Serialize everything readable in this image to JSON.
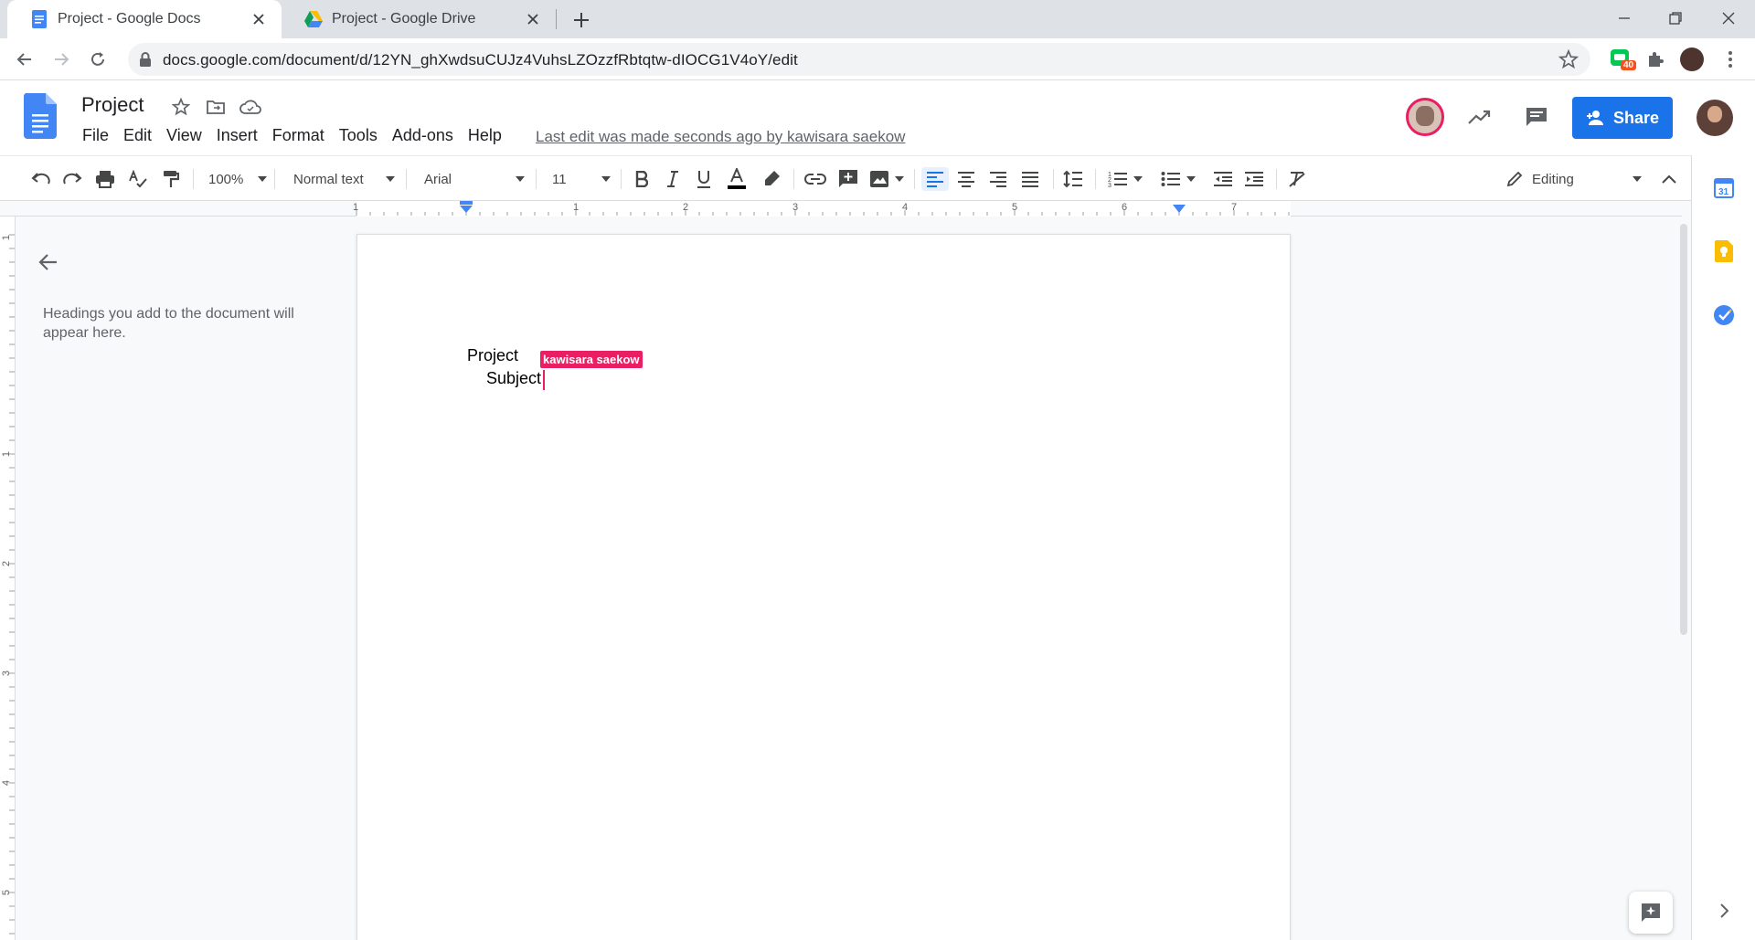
{
  "browser": {
    "tabs": [
      {
        "title": "Project - Google Docs",
        "active": true
      },
      {
        "title": "Project - Google Drive",
        "active": false
      }
    ],
    "url": "docs.google.com/document/d/12YN_ghXwdsuCUJz4VuhsLZOzzfRbtqtw-dIOCG1V4oY/edit",
    "extension_badge": "40"
  },
  "docs": {
    "title": "Project",
    "menu": [
      "File",
      "Edit",
      "View",
      "Insert",
      "Format",
      "Tools",
      "Add-ons",
      "Help"
    ],
    "last_edit": "Last edit was made seconds ago by kawisara saekow",
    "share_label": "Share"
  },
  "toolbar": {
    "zoom": "100%",
    "style": "Normal text",
    "font": "Arial",
    "size": "11",
    "mode": "Editing"
  },
  "ruler": {
    "numbers": [
      "1",
      "1",
      "2",
      "3",
      "4",
      "5",
      "6",
      "7"
    ]
  },
  "vruler": {
    "numbers": [
      "1",
      "1",
      "2",
      "3",
      "4",
      "5"
    ]
  },
  "outline": {
    "hint": "Headings you add to the document will appear here."
  },
  "document": {
    "lines": [
      "Project",
      "Subject"
    ],
    "collaborator": "kawisara saekow"
  },
  "colors": {
    "accent": "#1a73e8",
    "collaborator": "#e91e63"
  }
}
